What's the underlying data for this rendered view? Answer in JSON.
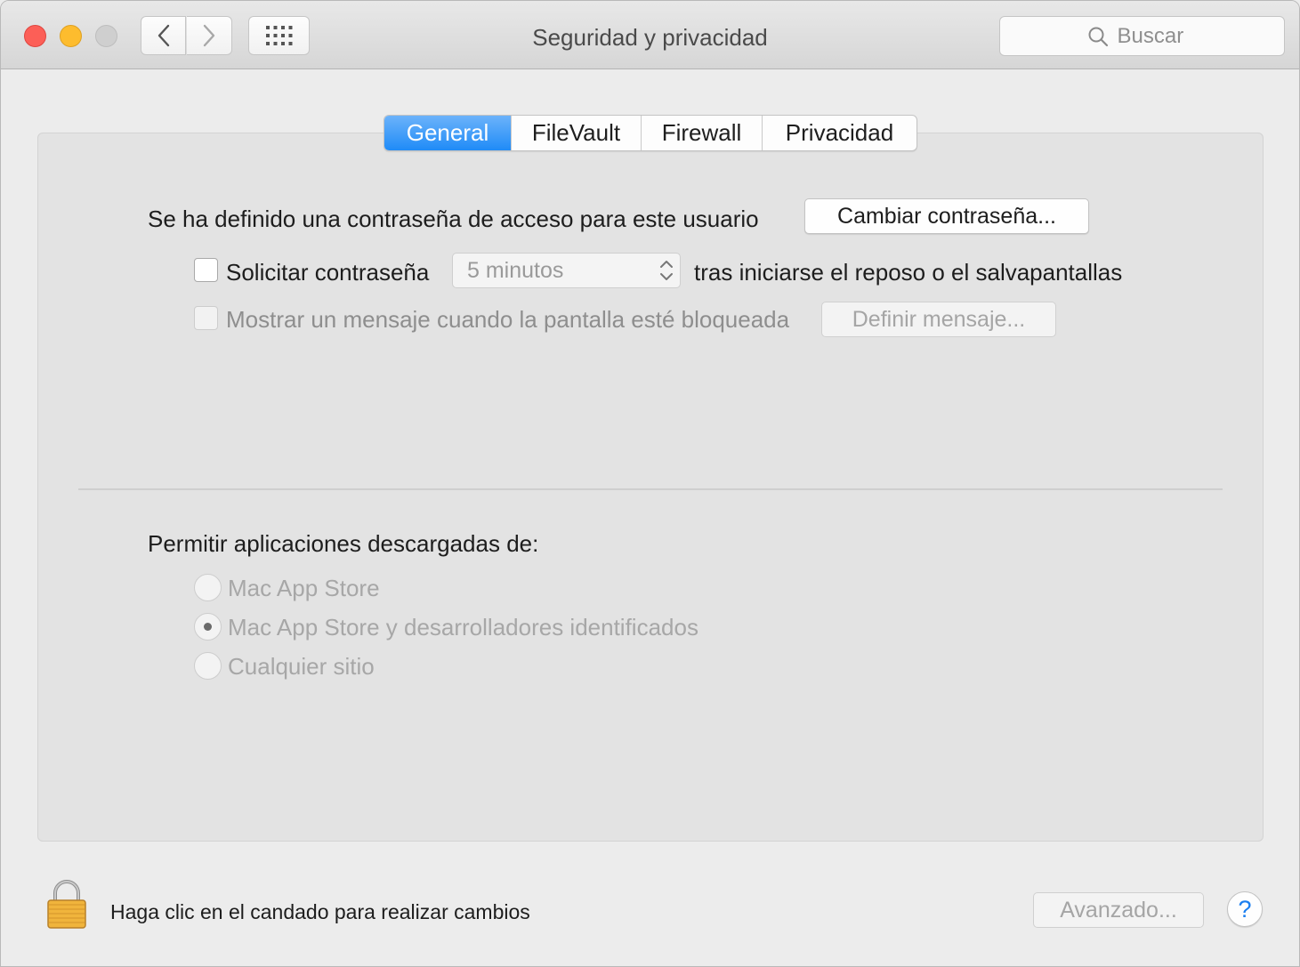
{
  "window": {
    "title": "Seguridad y privacidad",
    "search_placeholder": "Buscar"
  },
  "tabs": [
    {
      "label": "General",
      "active": true
    },
    {
      "label": "FileVault",
      "active": false
    },
    {
      "label": "Firewall",
      "active": false
    },
    {
      "label": "Privacidad",
      "active": false
    }
  ],
  "general": {
    "password_set_text": "Se ha definido una contraseña de acceso para este usuario",
    "change_password_button": "Cambiar contraseña...",
    "require_password": {
      "label": "Solicitar contraseña",
      "checked": false,
      "delay_value": "5 minutos",
      "suffix": "tras iniciarse el reposo o el salvapantallas"
    },
    "lock_message": {
      "label": "Mostrar un mensaje cuando la pantalla esté bloqueada",
      "checked": false,
      "button": "Definir mensaje..."
    }
  },
  "downloads": {
    "heading": "Permitir aplicaciones descargadas de:",
    "options": [
      {
        "label": "Mac App Store",
        "selected": false
      },
      {
        "label": "Mac App Store y desarrolladores identificados",
        "selected": true
      },
      {
        "label": "Cualquier sitio",
        "selected": false
      }
    ]
  },
  "footer": {
    "lock_text": "Haga clic en el candado para realizar cambios",
    "advanced_button": "Avanzado...",
    "help_label": "?"
  },
  "colors": {
    "accent": "#1f8bf7",
    "close": "#fc5f57",
    "minimize": "#fdbc2e",
    "lock_gold": "#f0b43c"
  }
}
